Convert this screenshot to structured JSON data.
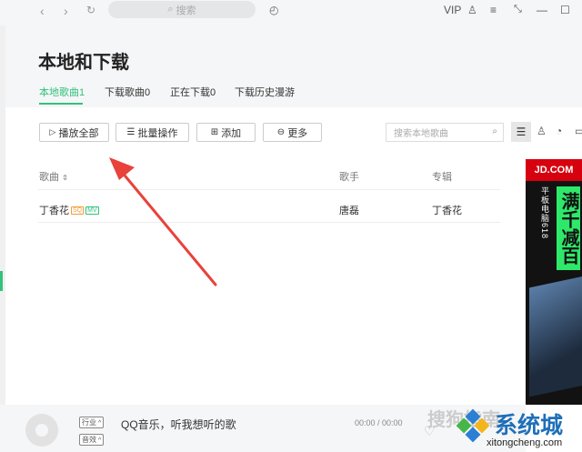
{
  "topbar": {
    "search_placeholder": "搜索",
    "vip_label": "VIP"
  },
  "page": {
    "title": "本地和下载"
  },
  "tabs": [
    {
      "label": "本地歌曲1"
    },
    {
      "label": "下载歌曲0"
    },
    {
      "label": "正在下载0"
    },
    {
      "label": "下载历史漫游"
    }
  ],
  "toolbar": {
    "play_all": "播放全部",
    "batch": "批量操作",
    "add": "添加",
    "more": "更多",
    "search_placeholder": "搜索本地歌曲"
  },
  "table": {
    "headers": {
      "song": "歌曲",
      "singer": "歌手",
      "album": "专辑"
    },
    "rows": [
      {
        "song": "丁香花",
        "tag_sq": "SQ",
        "tag_mv": "MV",
        "singer": "唐磊",
        "album": "丁香花"
      }
    ]
  },
  "ad": {
    "brand": "JD.COM",
    "slogan": "满千减百",
    "sub": "平板电脑618"
  },
  "player": {
    "lyric_btn": "行业",
    "effect_btn": "音效",
    "now_playing": "QQ音乐，听我想听的歌",
    "time": "00:00 / 00:00"
  },
  "watermark": {
    "sogou": "搜狗指南",
    "site_name": "系统城",
    "site_url": "xitongcheng.com"
  },
  "colors": {
    "accent": "#31c27c",
    "arrow": "#e8423a",
    "ad_red": "#d6000f",
    "ad_green": "#2ee86a"
  }
}
